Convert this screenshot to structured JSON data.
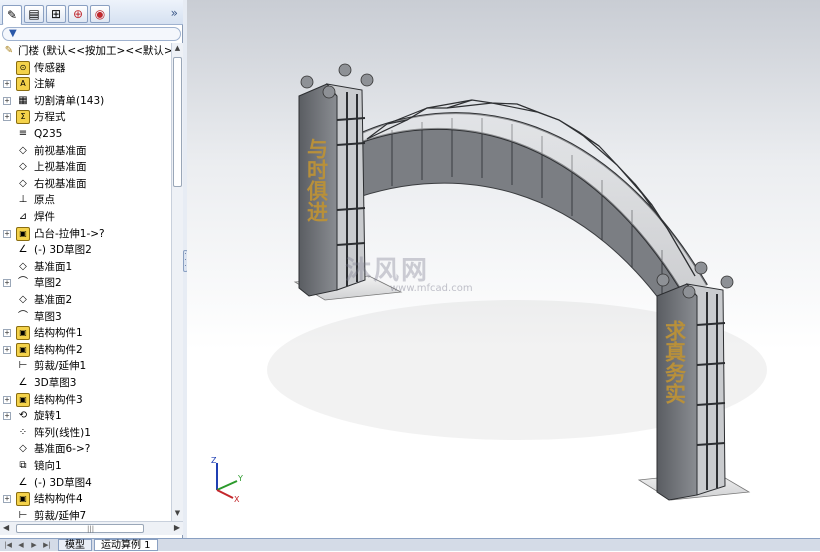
{
  "panel": {
    "tabs": [
      {
        "name": "feature-manager-tab",
        "glyph": "✎"
      },
      {
        "name": "property-manager-tab",
        "glyph": "▤"
      },
      {
        "name": "configuration-manager-tab",
        "glyph": "⊞"
      },
      {
        "name": "dimxpert-tab",
        "glyph": "⊕"
      },
      {
        "name": "display-manager-tab",
        "glyph": "◉"
      }
    ],
    "expand_glyph": "»",
    "filter_glyph": "⏚"
  },
  "tree": {
    "root": "门楼  (默认<<按加工><<默认>_显",
    "items": [
      {
        "label": "传感器",
        "icon": "sensor-icon",
        "glyph": "⊙",
        "expandable": false
      },
      {
        "label": "注解",
        "icon": "annotation-icon",
        "glyph": "A",
        "expandable": true
      },
      {
        "label": "切割清单(143)",
        "icon": "cut-list-icon",
        "glyph": "▦",
        "expandable": true
      },
      {
        "label": "方程式",
        "icon": "equation-icon",
        "glyph": "Σ",
        "expandable": true
      },
      {
        "label": "Q235",
        "icon": "material-icon",
        "glyph": "≡",
        "expandable": false
      },
      {
        "label": "前视基准面",
        "icon": "plane-icon",
        "glyph": "◇",
        "expandable": false
      },
      {
        "label": "上视基准面",
        "icon": "plane-icon",
        "glyph": "◇",
        "expandable": false
      },
      {
        "label": "右视基准面",
        "icon": "plane-icon",
        "glyph": "◇",
        "expandable": false
      },
      {
        "label": "原点",
        "icon": "origin-icon",
        "glyph": "⊥",
        "expandable": false
      },
      {
        "label": "焊件",
        "icon": "weldment-icon",
        "glyph": "⊿",
        "expandable": false
      },
      {
        "label": "凸台-拉伸1->?",
        "icon": "extrude-icon",
        "glyph": "▣",
        "expandable": true
      },
      {
        "label": "(-) 3D草图2",
        "icon": "3d-sketch-icon",
        "glyph": "∠",
        "expandable": false
      },
      {
        "label": "基准面1",
        "icon": "plane-icon",
        "glyph": "◇",
        "expandable": false
      },
      {
        "label": "草图2",
        "icon": "sketch-icon",
        "glyph": "⌒",
        "expandable": true
      },
      {
        "label": "基准面2",
        "icon": "plane-icon",
        "glyph": "◇",
        "expandable": false
      },
      {
        "label": "草图3",
        "icon": "sketch-icon",
        "glyph": "⌒",
        "expandable": false
      },
      {
        "label": "结构构件1",
        "icon": "structural-member-icon",
        "glyph": "▣",
        "expandable": true
      },
      {
        "label": "结构构件2",
        "icon": "structural-member-icon",
        "glyph": "▣",
        "expandable": true
      },
      {
        "label": "剪裁/延伸1",
        "icon": "trim-extend-icon",
        "glyph": "⊢",
        "expandable": false
      },
      {
        "label": "3D草图3",
        "icon": "3d-sketch-icon",
        "glyph": "∠",
        "expandable": false
      },
      {
        "label": "结构构件3",
        "icon": "structural-member-icon",
        "glyph": "▣",
        "expandable": true
      },
      {
        "label": "旋转1",
        "icon": "revolve-icon",
        "glyph": "⟲",
        "expandable": true
      },
      {
        "label": "阵列(线性)1",
        "icon": "linear-pattern-icon",
        "glyph": "⁘",
        "expandable": false
      },
      {
        "label": "基准面6->?",
        "icon": "plane-icon",
        "glyph": "◇",
        "expandable": false
      },
      {
        "label": "镜向1",
        "icon": "mirror-icon",
        "glyph": "⧉",
        "expandable": false
      },
      {
        "label": "(-) 3D草图4",
        "icon": "3d-sketch-icon",
        "glyph": "∠",
        "expandable": false
      },
      {
        "label": "结构构件4",
        "icon": "structural-member-icon",
        "glyph": "▣",
        "expandable": true
      },
      {
        "label": "剪裁/延伸7",
        "icon": "trim-extend-icon",
        "glyph": "⊢",
        "expandable": false
      }
    ]
  },
  "viewport": {
    "watermark": "沐风网",
    "watermark_url": "www.mfcad.com",
    "left_pillar_text": "与时俱进",
    "right_pillar_text": "求真务实",
    "triad": {
      "z": "Z",
      "y": "Y",
      "x": "X"
    }
  },
  "bottombar": {
    "tabs": [
      "模型",
      "运动算例 1"
    ],
    "active_tab": 1
  },
  "colors": {
    "panel_bg": "#ffffff",
    "steel": "#6b6e73",
    "steel_light": "#d9dadc",
    "gold": "#b8903a"
  }
}
